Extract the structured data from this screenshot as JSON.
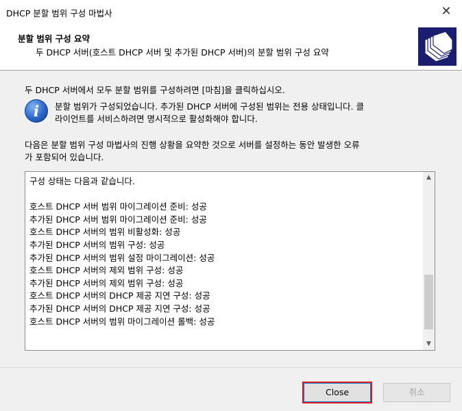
{
  "window": {
    "title": "DHCP 분할 범위 구성 마법사",
    "close_glyph": "✕"
  },
  "header": {
    "heading": "분할 범위 구성 요약",
    "subheading": "두 DHCP 서버(호스트 DHCP 서버 및 추가된 DHCP 서버)의 분할 범위 구성 요약",
    "icon": "folders-wizard-icon"
  },
  "content": {
    "intro": "두 DHCP 서버에서 모두 분할 범위를 구성하려면 [마침]을 클릭하십시오.",
    "info_icon_glyph": "i",
    "info_line1": "분할 범위가 구성되었습니다. 추가된 DHCP 서버에 구성된 범위는 전용 상태입니다. 클",
    "info_line2": "라이언트를 서비스하려면 명시적으로 활성화해야 합니다.",
    "summary_line1": "다음은 분할 범위 구성 마법사의 진행 상황을 요약한 것으로 서버를 설정하는 동안 발생한 오류",
    "summary_line2": "가 포함되어 있습니다.",
    "log": [
      "구성 상태는 다음과 같습니다.",
      "",
      "호스트 DHCP 서버 범위 마이그레이션 준비: 성공",
      "추가된 DHCP 서버 범위 마이그레이션 준비: 성공",
      "호스트 DHCP 서버의 범위 비활성화: 성공",
      "추가된 DHCP 서버의 범위 구성: 성공",
      "추가된 DHCP 서버의 범위 설정 마이그레이션: 성공",
      "호스트 DHCP 서버의 제외 범위 구성: 성공",
      "추가된 DHCP 서버의 제외 범위 구성: 성공",
      "호스트 DHCP 서버의 DHCP 제공 지연 구성: 성공",
      "추가된 DHCP 서버의 DHCP 제공 지연 구성: 성공",
      "호스트 DHCP 서버의 범위 마이그레이션 롤백: 성공"
    ],
    "scroll_up_glyph": "▲",
    "scroll_down_glyph": "▼"
  },
  "footer": {
    "close_label": "Close",
    "cancel_label": "취소"
  }
}
